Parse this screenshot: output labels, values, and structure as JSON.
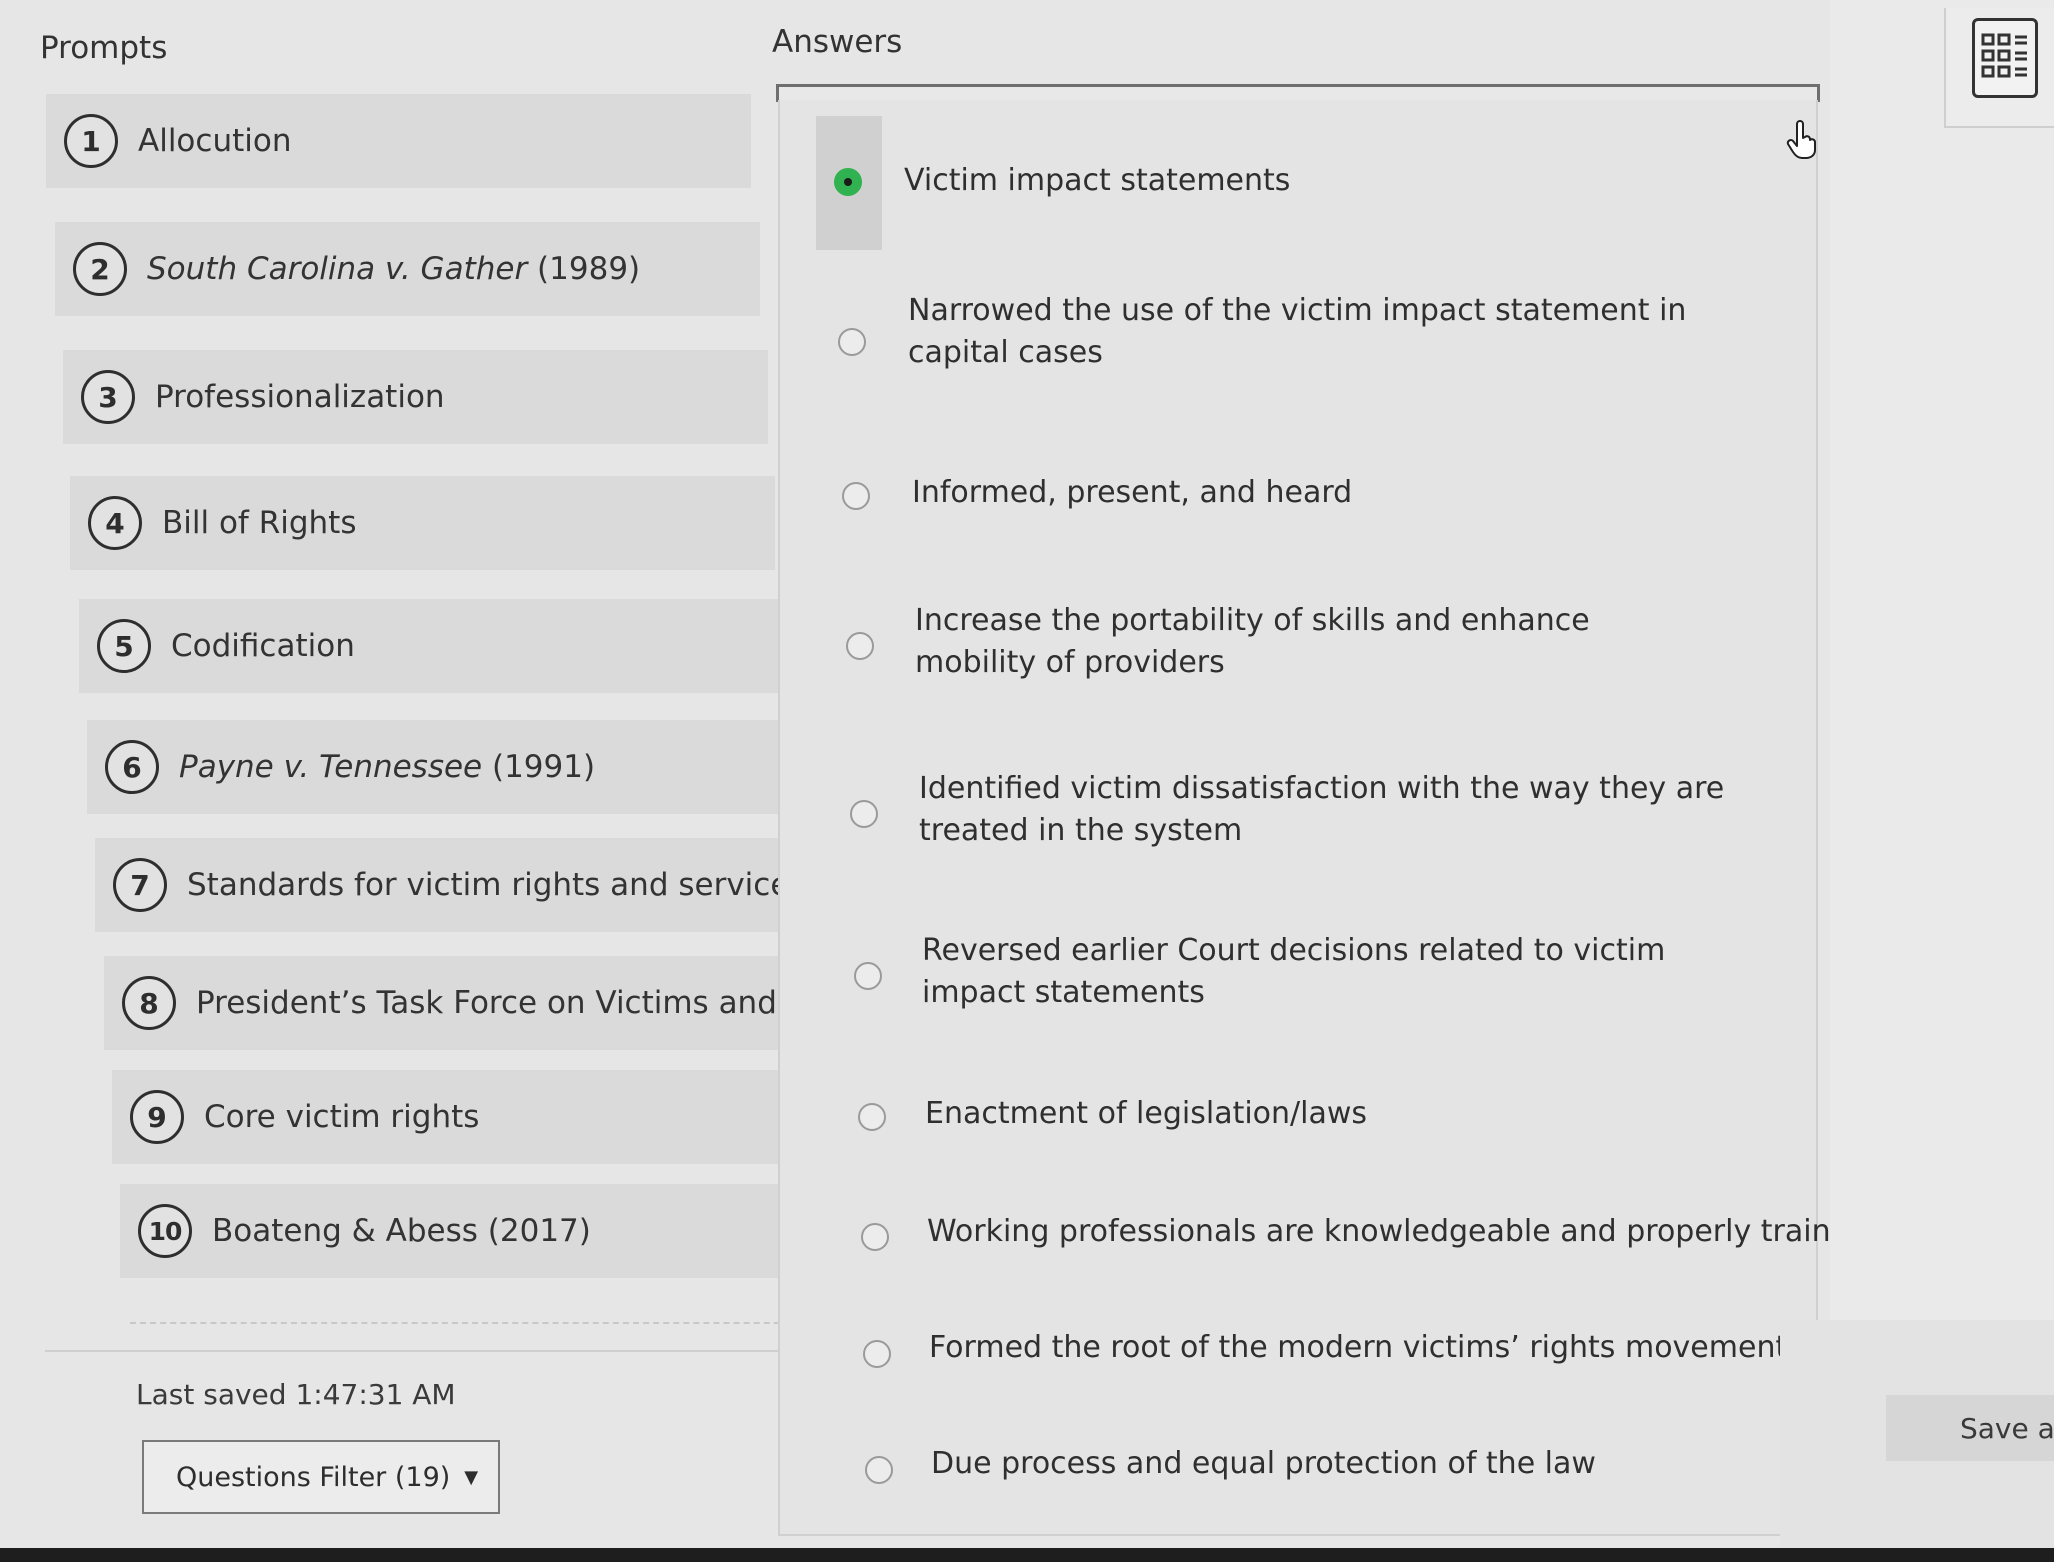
{
  "prompts": {
    "heading": "Prompts",
    "items": [
      {
        "number": "1",
        "label": "Allocution"
      },
      {
        "number": "2",
        "label_italic": "South Carolina v. Gather",
        "label": " (1989)"
      },
      {
        "number": "3",
        "label": "Professionalization"
      },
      {
        "number": "4",
        "label": "Bill of Rights"
      },
      {
        "number": "5",
        "label": "Codification"
      },
      {
        "number": "6",
        "label_italic": "Payne v. Tennessee",
        "label": " (1991)"
      },
      {
        "number": "7",
        "label": "Standards for victim rights and services"
      },
      {
        "number": "8",
        "label": "President’s Task Force on Victims and Crime"
      },
      {
        "number": "9",
        "label": "Core victim rights"
      },
      {
        "number": "10",
        "label": "Boateng & Abess (2017)"
      }
    ]
  },
  "answers": {
    "heading": "Answers",
    "items": [
      {
        "text": "Victim impact statements",
        "selected": true
      },
      {
        "text": "Narrowed the use of the victim impact statement in capital cases",
        "selected": false
      },
      {
        "text": "Informed, present, and heard",
        "selected": false
      },
      {
        "text": "Increase the portability of skills and enhance mobility of providers",
        "selected": false
      },
      {
        "text": "Identified victim dissatisfaction with the way they are treated in the system",
        "selected": false
      },
      {
        "text": "Reversed earlier Court decisions related to victim impact statements",
        "selected": false
      },
      {
        "text": "Enactment of legislation/laws",
        "selected": false
      },
      {
        "text": "Working professionals are knowledgeable and properly trained",
        "selected": false
      },
      {
        "text": "Formed the root of the modern victims’ rights movement",
        "selected": false
      },
      {
        "text": "Due process and equal protection of the law",
        "selected": false
      }
    ]
  },
  "footer": {
    "last_saved": "Last saved 1:47:31 AM",
    "filter_label": "Questions Filter (19)",
    "filter_caret": "▼"
  },
  "actions": {
    "save_label": "Save an"
  },
  "icons": {
    "calculator": "calculator-icon",
    "cursor": "hand-pointer-icon"
  },
  "colors": {
    "selected_radio": "#2fb24f"
  }
}
